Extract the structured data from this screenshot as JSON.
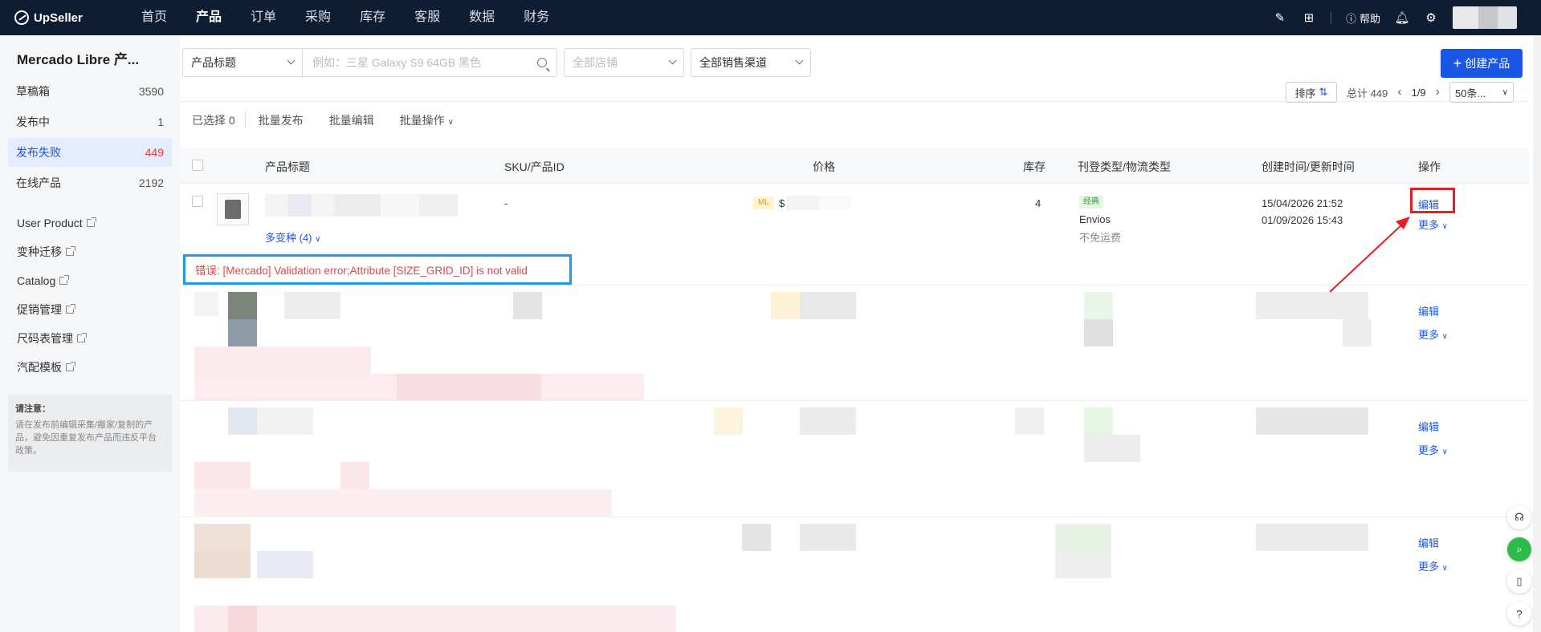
{
  "brand": "UpSeller",
  "nav": [
    "首页",
    "产品",
    "订单",
    "采购",
    "库存",
    "客服",
    "数据",
    "财务"
  ],
  "nav_active": "产品",
  "topbar": {
    "help_label": "帮助"
  },
  "sidebar": {
    "title": "Mercado Libre 产...",
    "items": [
      {
        "label": "草稿箱",
        "count": "3590"
      },
      {
        "label": "发布中",
        "count": "1"
      },
      {
        "label": "发布失败",
        "count": "449"
      },
      {
        "label": "在线产品",
        "count": "2192"
      }
    ],
    "links": [
      "User Product",
      "变种迁移",
      "Catalog",
      "促销管理",
      "尺码表管理",
      "汽配模板"
    ],
    "notice_title": "请注意：",
    "notice_text": "请在发布前编辑采集/搬家/复制的产品，避免因重复发布产品而违反平台政策。"
  },
  "filter": {
    "field": "产品标题",
    "search_placeholder": "例如：三星 Galaxy S9 64GB 黑色",
    "store": "全部店铺",
    "channel": "全部销售渠道",
    "create_label": "创建产品"
  },
  "actions": {
    "selected": "已选择 0",
    "bulk_publish": "批量发布",
    "bulk_edit": "批量编辑",
    "bulk_ops": "批量操作"
  },
  "pager": {
    "sort": "排序",
    "total": "总计 449",
    "page": "1/9",
    "per_page": "50条..."
  },
  "table": {
    "headers": [
      "产品标题",
      "SKU/产品ID",
      "价格",
      "库存",
      "刊登类型/物流类型",
      "创建时间/更新时间",
      "操作"
    ]
  },
  "row1": {
    "sku": "-",
    "variants": "多变种 (4)",
    "ml_tag": "ML",
    "price_prefix": "$",
    "stock": "4",
    "listing_tag": "经典",
    "logistics": "Envios",
    "shipping": "不免运费",
    "created": "15/04/2026 21:52",
    "updated": "01/09/2026 15:43",
    "edit": "编辑",
    "more": "更多",
    "error": "错误: [Mercado] Validation error;Attribute [SIZE_GRID_ID] is not valid"
  },
  "other_rows": [
    {
      "edit": "编辑",
      "more": "更多"
    },
    {
      "edit": "编辑",
      "more": "更多"
    },
    {
      "edit": "编辑",
      "more": "更多"
    }
  ],
  "colors": {
    "nav_bg": "#0f1d33",
    "primary": "#1a57e6",
    "error": "#e0464a",
    "highlight_red": "#e51e26",
    "highlight_blue": "#1e9ce0"
  }
}
